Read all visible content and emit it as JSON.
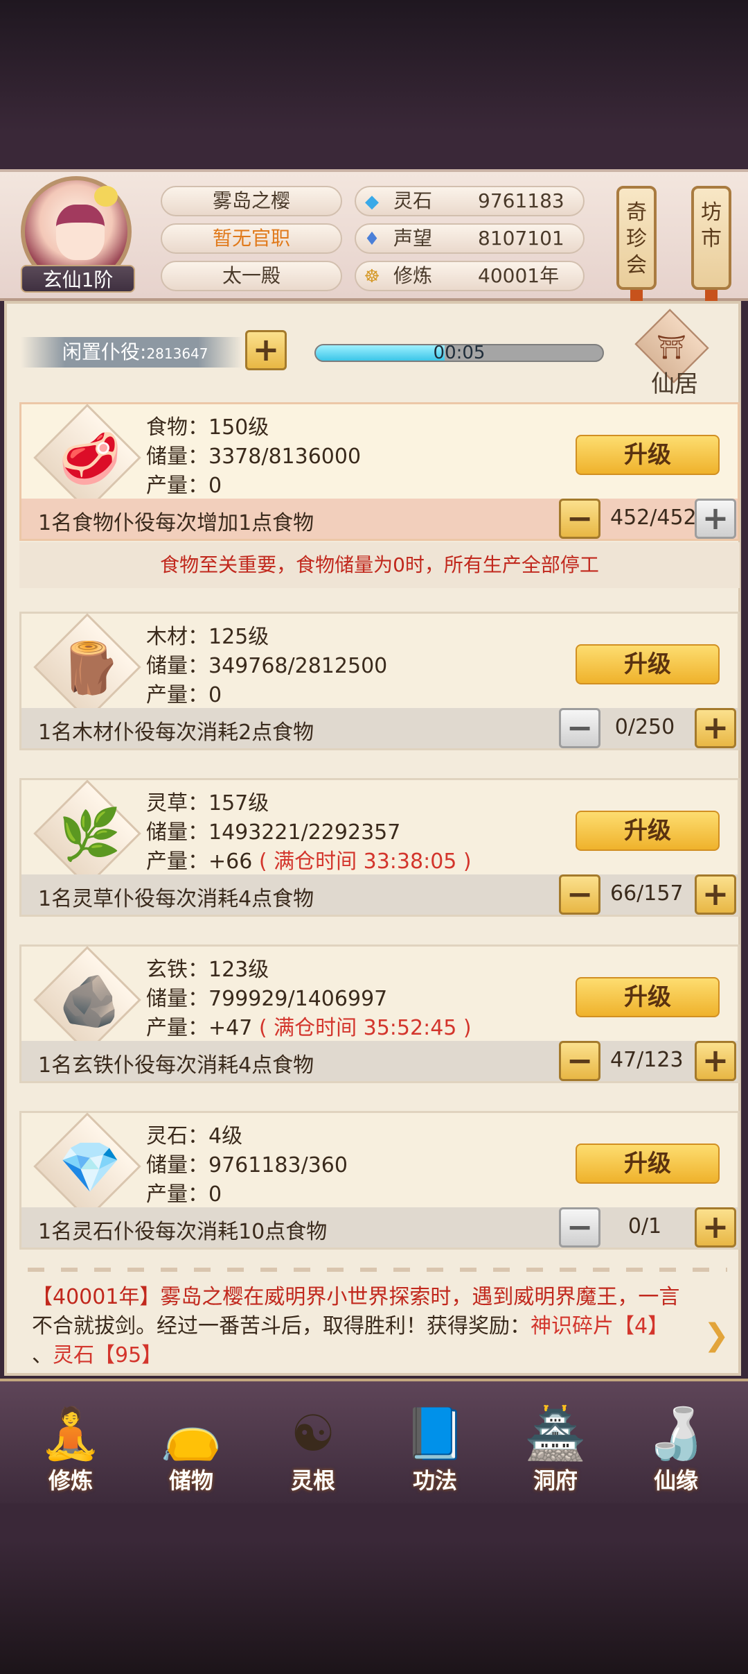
{
  "header": {
    "rank": "玄仙1阶",
    "name": "雾岛之樱",
    "office": "暂无官职",
    "palace": "太一殿",
    "stats": [
      {
        "label": "灵石",
        "value": "9761183",
        "icon": "spirit-stone-icon"
      },
      {
        "label": "声望",
        "value": "8107101",
        "icon": "prestige-icon"
      },
      {
        "label": "修炼",
        "value": "40001年",
        "icon": "meditation-icon"
      }
    ],
    "signs": [
      {
        "label": "奇珍会"
      },
      {
        "label": "坊市"
      }
    ]
  },
  "idle": {
    "label": "闲置仆役:",
    "count": "2813647",
    "add": "+",
    "timer": "00:05",
    "progress": 0.45,
    "home_label": "仙居"
  },
  "resources": [
    {
      "name": "食物：150级",
      "storage": "储量：3378/8136000",
      "output": "产量：0",
      "output_extra": "",
      "desc": "1名食物仆役每次增加1点食物",
      "count": "452/452",
      "upgrade": "升级",
      "icon": "meat-icon",
      "minus": "−",
      "plus": "+"
    },
    {
      "name": "木材：125级",
      "storage": "储量：349768/2812500",
      "output": "产量：0",
      "output_extra": "",
      "desc": "1名木材仆役每次消耗2点食物",
      "count": "0/250",
      "upgrade": "升级",
      "icon": "wood-icon",
      "minus": "−",
      "plus": "+"
    },
    {
      "name": "灵草：157级",
      "storage": "储量：1493221/2292357",
      "output": "产量：+66",
      "output_extra": "( 满仓时间 33:38:05 )",
      "desc": "1名灵草仆役每次消耗4点食物",
      "count": "66/157",
      "upgrade": "升级",
      "icon": "herb-icon",
      "minus": "−",
      "plus": "+"
    },
    {
      "name": "玄铁：123级",
      "storage": "储量：799929/1406997",
      "output": "产量：+47",
      "output_extra": "( 满仓时间 35:52:45 )",
      "desc": "1名玄铁仆役每次消耗4点食物",
      "count": "47/123",
      "upgrade": "升级",
      "icon": "iron-ore-icon",
      "minus": "−",
      "plus": "+"
    },
    {
      "name": "灵石：4级",
      "storage": "储量：9761183/360",
      "output": "产量：0",
      "output_extra": "",
      "desc": "1名灵石仆役每次消耗10点食物",
      "count": "0/1",
      "upgrade": "升级",
      "icon": "spirit-crystal-icon",
      "minus": "−",
      "plus": "+"
    }
  ],
  "food_notice": "食物至关重要，食物储量为0时，所有生产全部停工",
  "log": {
    "line1": "【40001年】雾岛之樱在威明界小世界探索时，遇到威明界魔王，一言",
    "line2a": "不合就拔剑。经过一番苦斗后，取得胜利！获得奖励：",
    "reward1": "神识碎片【4】",
    "line3a": "、",
    "reward2": "灵石【95】"
  },
  "nav": [
    {
      "label": "修炼",
      "icon": "cultivate-icon"
    },
    {
      "label": "储物",
      "icon": "storage-bag-icon"
    },
    {
      "label": "灵根",
      "icon": "spirit-root-icon"
    },
    {
      "label": "功法",
      "icon": "technique-book-icon"
    },
    {
      "label": "洞府",
      "icon": "cave-dwelling-icon"
    },
    {
      "label": "仙缘",
      "icon": "immortal-fate-icon"
    }
  ]
}
